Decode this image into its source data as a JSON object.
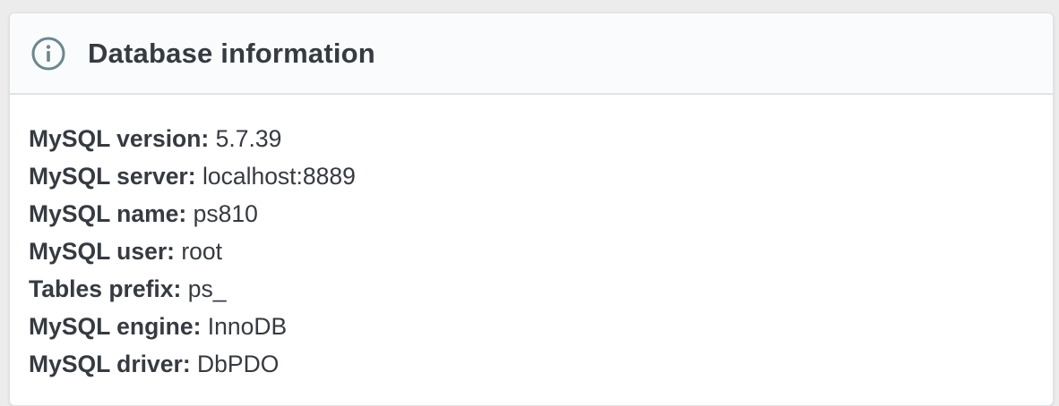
{
  "card": {
    "title": "Database information",
    "icon": "info-icon",
    "rows": [
      {
        "label": "MySQL version:",
        "value": "5.7.39"
      },
      {
        "label": "MySQL server:",
        "value": "localhost:8889"
      },
      {
        "label": "MySQL name:",
        "value": "ps810"
      },
      {
        "label": "MySQL user:",
        "value": "root"
      },
      {
        "label": "Tables prefix:",
        "value": "ps_"
      },
      {
        "label": "MySQL engine:",
        "value": "InnoDB"
      },
      {
        "label": "MySQL driver:",
        "value": "DbPDO"
      }
    ]
  },
  "colors": {
    "text": "#363a41",
    "icon": "#6c868e",
    "header_bg": "#fafbfc",
    "border": "#dde3e7"
  }
}
